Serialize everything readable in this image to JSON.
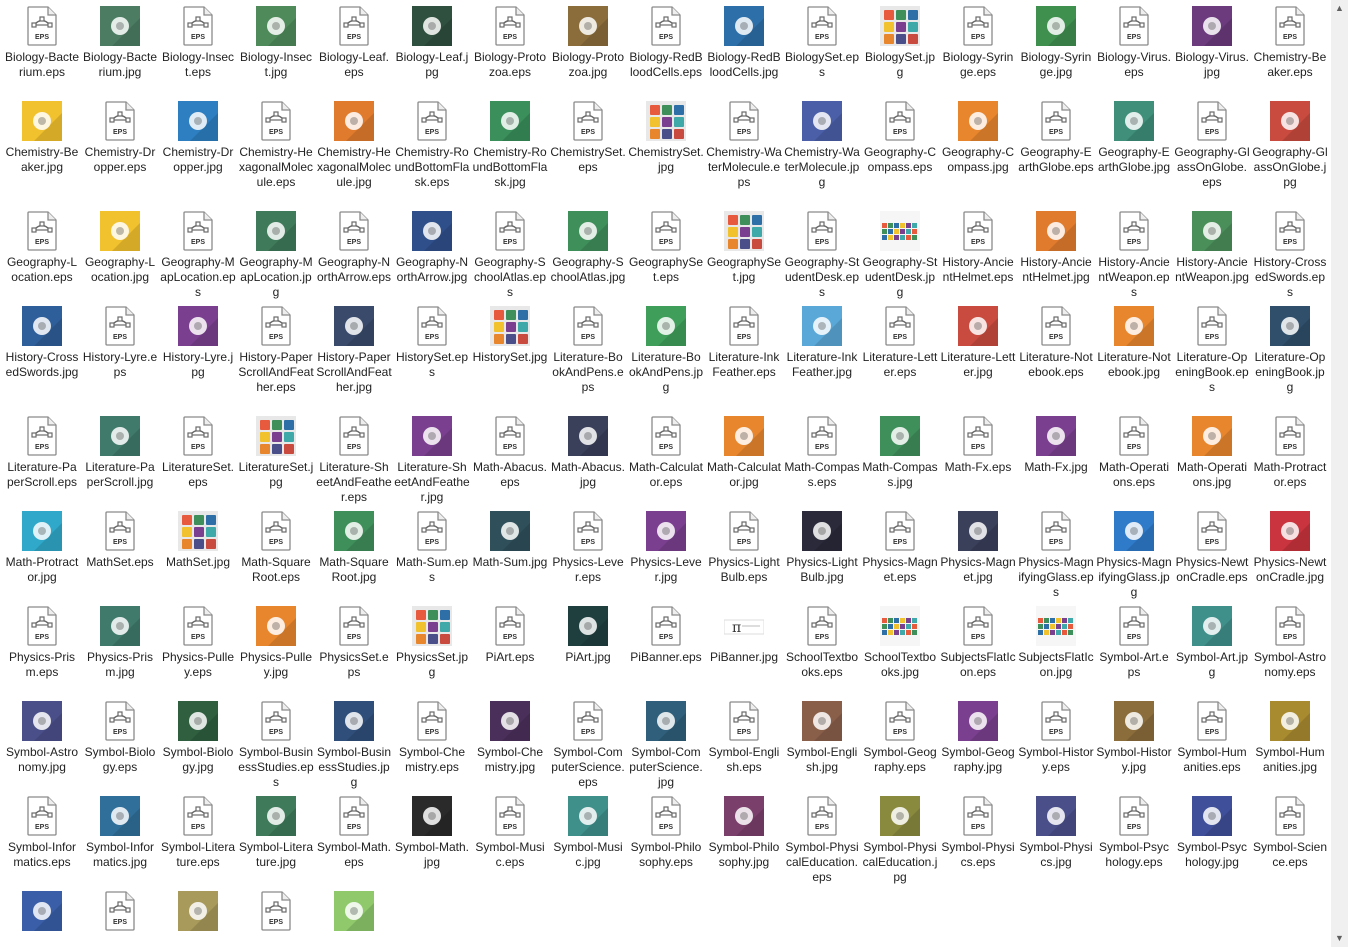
{
  "window": {
    "title": ""
  },
  "scrollbar": {
    "up_glyph": "▲",
    "down_glyph": "▼"
  },
  "files": [
    {
      "name": "Biology-Bacterium.eps",
      "type": "eps"
    },
    {
      "name": "Biology-Bacterium.jpg",
      "type": "jpg",
      "color": "#4c7d63",
      "icon": "bacterium-icon"
    },
    {
      "name": "Biology-Insect.eps",
      "type": "eps"
    },
    {
      "name": "Biology-Insect.jpg",
      "type": "jpg",
      "color": "#4f8a5a",
      "icon": "insect-icon"
    },
    {
      "name": "Biology-Leaf.eps",
      "type": "eps"
    },
    {
      "name": "Biology-Leaf.jpg",
      "type": "jpg",
      "color": "#2f4f3f",
      "icon": "leaf-icon"
    },
    {
      "name": "Biology-Protozoa.eps",
      "type": "eps"
    },
    {
      "name": "Biology-Protozoa.jpg",
      "type": "jpg",
      "color": "#8a6d3b",
      "icon": "protozoa-icon"
    },
    {
      "name": "Biology-RedBloodCells.eps",
      "type": "eps"
    },
    {
      "name": "Biology-RedBloodCells.jpg",
      "type": "jpg",
      "color": "#2d6fa8",
      "icon": "blood-cells-icon"
    },
    {
      "name": "BiologySet.eps",
      "type": "eps"
    },
    {
      "name": "BiologySet.jpg",
      "type": "jpg",
      "color": "#e8e8e8",
      "icon": "icon-set-grid"
    },
    {
      "name": "Biology-Syringe.eps",
      "type": "eps"
    },
    {
      "name": "Biology-Syringe.jpg",
      "type": "jpg",
      "color": "#3f8f4f",
      "icon": "syringe-icon"
    },
    {
      "name": "Biology-Virus.eps",
      "type": "eps"
    },
    {
      "name": "Biology-Virus.jpg",
      "type": "jpg",
      "color": "#6b3b7d",
      "icon": "virus-icon"
    },
    {
      "name": "Chemistry-Beaker.eps",
      "type": "eps"
    },
    {
      "name": "Chemistry-Beaker.jpg",
      "type": "jpg",
      "color": "#f2c12e",
      "icon": "beaker-icon"
    },
    {
      "name": "Chemistry-Dropper.eps",
      "type": "eps"
    },
    {
      "name": "Chemistry-Dropper.jpg",
      "type": "jpg",
      "color": "#2d7fc1",
      "icon": "dropper-icon"
    },
    {
      "name": "Chemistry-HexagonalMolecule.eps",
      "type": "eps"
    },
    {
      "name": "Chemistry-HexagonalMolecule.jpg",
      "type": "jpg",
      "color": "#e07b2e",
      "icon": "molecule-icon"
    },
    {
      "name": "Chemistry-RoundBottomFlask.eps",
      "type": "eps"
    },
    {
      "name": "Chemistry-RoundBottomFlask.jpg",
      "type": "jpg",
      "color": "#3a8f5a",
      "icon": "flask-icon"
    },
    {
      "name": "ChemistrySet.eps",
      "type": "eps"
    },
    {
      "name": "ChemistrySet.jpg",
      "type": "jpg",
      "color": "#e8e8e8",
      "icon": "icon-set-grid"
    },
    {
      "name": "Chemistry-WaterMolecule.eps",
      "type": "eps"
    },
    {
      "name": "Chemistry-WaterMolecule.jpg",
      "type": "jpg",
      "color": "#4a5fa8",
      "icon": "water-molecule-icon"
    },
    {
      "name": "Geography-Compass.eps",
      "type": "eps"
    },
    {
      "name": "Geography-Compass.jpg",
      "type": "jpg",
      "color": "#e8862e",
      "icon": "compass-icon"
    },
    {
      "name": "Geography-EarthGlobe.eps",
      "type": "eps"
    },
    {
      "name": "Geography-EarthGlobe.jpg",
      "type": "jpg",
      "color": "#3f8f7a",
      "icon": "globe-icon"
    },
    {
      "name": "Geography-GlassOnGlobe.eps",
      "type": "eps"
    },
    {
      "name": "Geography-GlassOnGlobe.jpg",
      "type": "jpg",
      "color": "#c94a3e",
      "icon": "magnifier-globe-icon"
    },
    {
      "name": "Geography-Location.eps",
      "type": "eps"
    },
    {
      "name": "Geography-Location.jpg",
      "type": "jpg",
      "color": "#f2c12e",
      "icon": "location-pin-icon"
    },
    {
      "name": "Geography-MapLocation.eps",
      "type": "eps"
    },
    {
      "name": "Geography-MapLocation.jpg",
      "type": "jpg",
      "color": "#3f7a5a",
      "icon": "map-icon"
    },
    {
      "name": "Geography-NorthArrow.eps",
      "type": "eps"
    },
    {
      "name": "Geography-NorthArrow.jpg",
      "type": "jpg",
      "color": "#2f4f8a",
      "icon": "north-arrow-icon"
    },
    {
      "name": "Geography-SchoolAtlas.eps",
      "type": "eps"
    },
    {
      "name": "Geography-SchoolAtlas.jpg",
      "type": "jpg",
      "color": "#3f8f5a",
      "icon": "atlas-icon"
    },
    {
      "name": "GeographySet.eps",
      "type": "eps"
    },
    {
      "name": "GeographySet.jpg",
      "type": "jpg",
      "color": "#e8e8e8",
      "icon": "icon-set-grid"
    },
    {
      "name": "Geography-StudentDesk.eps",
      "type": "eps"
    },
    {
      "name": "Geography-StudentDesk.jpg",
      "type": "jpg",
      "color": "#f6f6f6",
      "icon": "student-desk-icon"
    },
    {
      "name": "History-AncientHelmet.eps",
      "type": "eps"
    },
    {
      "name": "History-AncientHelmet.jpg",
      "type": "jpg",
      "color": "#e07b2e",
      "icon": "helmet-icon"
    },
    {
      "name": "History-AncientWeapon.eps",
      "type": "eps"
    },
    {
      "name": "History-AncientWeapon.jpg",
      "type": "jpg",
      "color": "#4a8f5a",
      "icon": "weapon-icon"
    },
    {
      "name": "History-CrossedSwords.eps",
      "type": "eps"
    },
    {
      "name": "History-CrossedSwords.jpg",
      "type": "jpg",
      "color": "#2f5f9a",
      "icon": "crossed-swords-icon"
    },
    {
      "name": "History-Lyre.eps",
      "type": "eps"
    },
    {
      "name": "History-Lyre.jpg",
      "type": "jpg",
      "color": "#7a3f8f",
      "icon": "lyre-icon"
    },
    {
      "name": "History-PaperScrollAndFeather.eps",
      "type": "eps"
    },
    {
      "name": "History-PaperScrollAndFeather.jpg",
      "type": "jpg",
      "color": "#3a4a6b",
      "icon": "scroll-feather-icon"
    },
    {
      "name": "HistorySet.eps",
      "type": "eps"
    },
    {
      "name": "HistorySet.jpg",
      "type": "jpg",
      "color": "#e8e8e8",
      "icon": "icon-set-grid"
    },
    {
      "name": "Literature-BookAndPens.eps",
      "type": "eps"
    },
    {
      "name": "Literature-BookAndPens.jpg",
      "type": "jpg",
      "color": "#3f9f5a",
      "icon": "book-pens-icon"
    },
    {
      "name": "Literature-InkFeather.eps",
      "type": "eps"
    },
    {
      "name": "Literature-InkFeather.jpg",
      "type": "jpg",
      "color": "#5aa8d8",
      "icon": "ink-feather-icon"
    },
    {
      "name": "Literature-Letter.eps",
      "type": "eps"
    },
    {
      "name": "Literature-Letter.jpg",
      "type": "jpg",
      "color": "#c94a3e",
      "icon": "letter-icon"
    },
    {
      "name": "Literature-Notebook.eps",
      "type": "eps"
    },
    {
      "name": "Literature-Notebook.jpg",
      "type": "jpg",
      "color": "#e8862e",
      "icon": "notebook-icon"
    },
    {
      "name": "Literature-OpeningBook.eps",
      "type": "eps"
    },
    {
      "name": "Literature-OpeningBook.jpg",
      "type": "jpg",
      "color": "#2f4f6b",
      "icon": "open-book-icon"
    },
    {
      "name": "Literature-PaperScroll.eps",
      "type": "eps"
    },
    {
      "name": "Literature-PaperScroll.jpg",
      "type": "jpg",
      "color": "#3f7a6b",
      "icon": "paper-scroll-icon"
    },
    {
      "name": "LiteratureSet.eps",
      "type": "eps"
    },
    {
      "name": "LiteratureSet.jpg",
      "type": "jpg",
      "color": "#e8e8e8",
      "icon": "icon-set-grid"
    },
    {
      "name": "Literature-SheetAndFeather.eps",
      "type": "eps"
    },
    {
      "name": "Literature-SheetAndFeather.jpg",
      "type": "jpg",
      "color": "#7a3f8f",
      "icon": "sheet-feather-icon"
    },
    {
      "name": "Math-Abacus.eps",
      "type": "eps"
    },
    {
      "name": "Math-Abacus.jpg",
      "type": "jpg",
      "color": "#3a3f5a",
      "icon": "abacus-icon"
    },
    {
      "name": "Math-Calculator.eps",
      "type": "eps"
    },
    {
      "name": "Math-Calculator.jpg",
      "type": "jpg",
      "color": "#e8862e",
      "icon": "calculator-icon"
    },
    {
      "name": "Math-Compass.eps",
      "type": "eps"
    },
    {
      "name": "Math-Compass.jpg",
      "type": "jpg",
      "color": "#3f8f5a",
      "icon": "drawing-compass-icon"
    },
    {
      "name": "Math-Fx.eps",
      "type": "eps"
    },
    {
      "name": "Math-Fx.jpg",
      "type": "jpg",
      "color": "#7a3f8f",
      "icon": "fx-icon"
    },
    {
      "name": "Math-Operations.eps",
      "type": "eps"
    },
    {
      "name": "Math-Operations.jpg",
      "type": "jpg",
      "color": "#e8862e",
      "icon": "operations-icon"
    },
    {
      "name": "Math-Protractor.eps",
      "type": "eps"
    },
    {
      "name": "Math-Protractor.jpg",
      "type": "jpg",
      "color": "#2fa8c9",
      "icon": "protractor-icon"
    },
    {
      "name": "MathSet.eps",
      "type": "eps"
    },
    {
      "name": "MathSet.jpg",
      "type": "jpg",
      "color": "#e8e8e8",
      "icon": "icon-set-grid"
    },
    {
      "name": "Math-SquareRoot.eps",
      "type": "eps"
    },
    {
      "name": "Math-SquareRoot.jpg",
      "type": "jpg",
      "color": "#3f8f5a",
      "icon": "square-root-icon"
    },
    {
      "name": "Math-Sum.eps",
      "type": "eps"
    },
    {
      "name": "Math-Sum.jpg",
      "type": "jpg",
      "color": "#2f4f5a",
      "icon": "sigma-icon"
    },
    {
      "name": "Physics-Lever.eps",
      "type": "eps"
    },
    {
      "name": "Physics-Lever.jpg",
      "type": "jpg",
      "color": "#7a3f8f",
      "icon": "lever-icon"
    },
    {
      "name": "Physics-LightBulb.eps",
      "type": "eps"
    },
    {
      "name": "Physics-LightBulb.jpg",
      "type": "jpg",
      "color": "#2a2a3a",
      "icon": "light-bulb-icon"
    },
    {
      "name": "Physics-Magnet.eps",
      "type": "eps"
    },
    {
      "name": "Physics-Magnet.jpg",
      "type": "jpg",
      "color": "#3a3f5a",
      "icon": "magnet-icon"
    },
    {
      "name": "Physics-MagnifyingGlass.eps",
      "type": "eps"
    },
    {
      "name": "Physics-MagnifyingGlass.jpg",
      "type": "jpg",
      "color": "#2f7ac9",
      "icon": "magnifying-glass-icon"
    },
    {
      "name": "Physics-NewtonCradle.eps",
      "type": "eps"
    },
    {
      "name": "Physics-NewtonCradle.jpg",
      "type": "jpg",
      "color": "#c9343e",
      "icon": "newton-cradle-icon"
    },
    {
      "name": "Physics-Prism.eps",
      "type": "eps"
    },
    {
      "name": "Physics-Prism.jpg",
      "type": "jpg",
      "color": "#3f7a6b",
      "icon": "prism-icon"
    },
    {
      "name": "Physics-Pulley.eps",
      "type": "eps"
    },
    {
      "name": "Physics-Pulley.jpg",
      "type": "jpg",
      "color": "#e8862e",
      "icon": "pulley-icon"
    },
    {
      "name": "PhysicsSet.eps",
      "type": "eps"
    },
    {
      "name": "PhysicsSet.jpg",
      "type": "jpg",
      "color": "#e8e8e8",
      "icon": "icon-set-grid"
    },
    {
      "name": "PiArt.eps",
      "type": "eps"
    },
    {
      "name": "PiArt.jpg",
      "type": "jpg",
      "color": "#1f3f3f",
      "icon": "pi-art-icon"
    },
    {
      "name": "PiBanner.eps",
      "type": "eps"
    },
    {
      "name": "PiBanner.jpg",
      "type": "jpg",
      "color": "#f6f6f6",
      "icon": "pi-banner-icon"
    },
    {
      "name": "SchoolTextbooks.eps",
      "type": "eps"
    },
    {
      "name": "SchoolTextbooks.jpg",
      "type": "jpg",
      "color": "#f6f6f6",
      "icon": "textbooks-icon"
    },
    {
      "name": "SubjectsFlatIcon.eps",
      "type": "eps"
    },
    {
      "name": "SubjectsFlatIcon.jpg",
      "type": "jpg",
      "color": "#f6f6f6",
      "icon": "subjects-flat-icon"
    },
    {
      "name": "Symbol-Art.eps",
      "type": "eps"
    },
    {
      "name": "Symbol-Art.jpg",
      "type": "jpg",
      "color": "#3f8f8a",
      "icon": "palette-icon"
    },
    {
      "name": "Symbol-Astronomy.eps",
      "type": "eps"
    },
    {
      "name": "Symbol-Astronomy.jpg",
      "type": "jpg",
      "color": "#4a4f8a",
      "icon": "telescope-icon"
    },
    {
      "name": "Symbol-Biology.eps",
      "type": "eps"
    },
    {
      "name": "Symbol-Biology.jpg",
      "type": "jpg",
      "color": "#2f5f3f",
      "icon": "dna-icon"
    },
    {
      "name": "Symbol-BusinessStudies.eps",
      "type": "eps"
    },
    {
      "name": "Symbol-BusinessStudies.jpg",
      "type": "jpg",
      "color": "#2f4f7a",
      "icon": "growth-chart-icon"
    },
    {
      "name": "Symbol-Chemistry.eps",
      "type": "eps"
    },
    {
      "name": "Symbol-Chemistry.jpg",
      "type": "jpg",
      "color": "#4a2f5a",
      "icon": "chemistry-flask-icon"
    },
    {
      "name": "Symbol-ComputerScience.eps",
      "type": "eps"
    },
    {
      "name": "Symbol-ComputerScience.jpg",
      "type": "jpg",
      "color": "#2f5f7a",
      "icon": "chip-icon"
    },
    {
      "name": "Symbol-English.eps",
      "type": "eps"
    },
    {
      "name": "Symbol-English.jpg",
      "type": "jpg",
      "color": "#8a5f4a",
      "icon": "english-icon"
    },
    {
      "name": "Symbol-Geography.eps",
      "type": "eps"
    },
    {
      "name": "Symbol-Geography.jpg",
      "type": "jpg",
      "color": "#7a3f8f",
      "icon": "desk-globe-icon"
    },
    {
      "name": "Symbol-History.eps",
      "type": "eps"
    },
    {
      "name": "Symbol-History.jpg",
      "type": "jpg",
      "color": "#8a6d3b",
      "icon": "history-scroll-icon"
    },
    {
      "name": "Symbol-Humanities.eps",
      "type": "eps"
    },
    {
      "name": "Symbol-Humanities.jpg",
      "type": "jpg",
      "color": "#a88a2f",
      "icon": "humanities-icon"
    },
    {
      "name": "Symbol-Informatics.eps",
      "type": "eps"
    },
    {
      "name": "Symbol-Informatics.jpg",
      "type": "jpg",
      "color": "#2f6f9a",
      "icon": "laptop-icon"
    },
    {
      "name": "Symbol-Literature.eps",
      "type": "eps"
    },
    {
      "name": "Symbol-Literature.jpg",
      "type": "jpg",
      "color": "#3f7a5a",
      "icon": "literature-book-icon"
    },
    {
      "name": "Symbol-Math.eps",
      "type": "eps"
    },
    {
      "name": "Symbol-Math.jpg",
      "type": "jpg",
      "color": "#2a2a2a",
      "icon": "pi-icon"
    },
    {
      "name": "Symbol-Music.eps",
      "type": "eps"
    },
    {
      "name": "Symbol-Music.jpg",
      "type": "jpg",
      "color": "#3f8f8a",
      "icon": "treble-clef-icon"
    },
    {
      "name": "Symbol-Philosophy.eps",
      "type": "eps"
    },
    {
      "name": "Symbol-Philosophy.jpg",
      "type": "jpg",
      "color": "#7a3f6b",
      "icon": "head-icon"
    },
    {
      "name": "Symbol-PhysicalEducation.eps",
      "type": "eps"
    },
    {
      "name": "Symbol-PhysicalEducation.jpg",
      "type": "jpg",
      "color": "#8a8a3f",
      "icon": "basketball-icon"
    },
    {
      "name": "Symbol-Physics.eps",
      "type": "eps"
    },
    {
      "name": "Symbol-Physics.jpg",
      "type": "jpg",
      "color": "#4a4f8a",
      "icon": "atom-icon"
    },
    {
      "name": "Symbol-Psychology.eps",
      "type": "eps"
    },
    {
      "name": "Symbol-Psychology.jpg",
      "type": "jpg",
      "color": "#3f4f9a",
      "icon": "brain-icon"
    },
    {
      "name": "Symbol-Science.eps",
      "type": "eps"
    },
    {
      "name": "",
      "type": "jpg",
      "color": "#3a5fa8",
      "icon": "microscope-icon"
    },
    {
      "name": "",
      "type": "eps"
    },
    {
      "name": "",
      "type": "jpg",
      "color": "#a89a5a",
      "icon": "social-studies-icon"
    },
    {
      "name": "",
      "type": "eps"
    },
    {
      "name": "",
      "type": "jpg",
      "color": "#8fc96b",
      "icon": "tree-icon"
    }
  ]
}
